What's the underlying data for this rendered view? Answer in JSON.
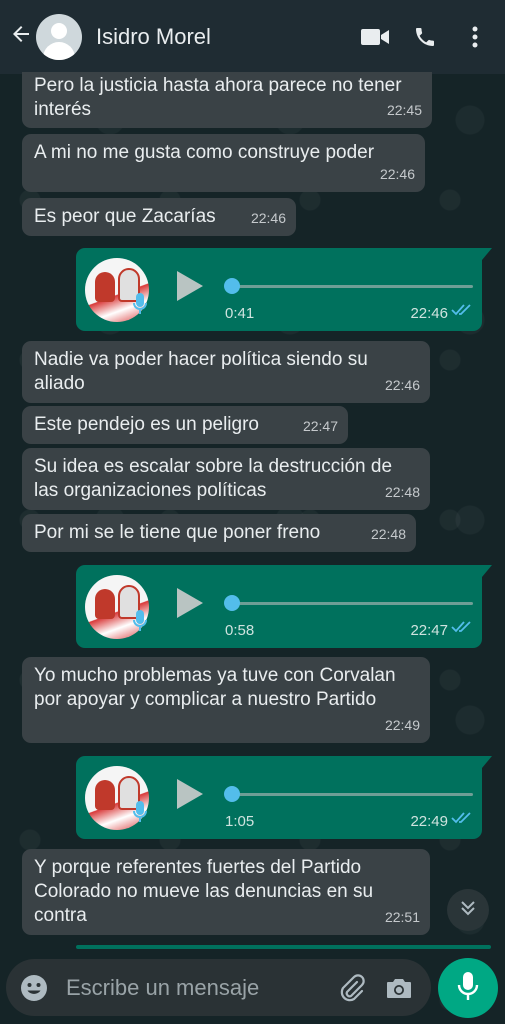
{
  "header": {
    "contact_name": "Isidro Morel"
  },
  "messages": [
    {
      "text": "Pero la justicia hasta ahora parece no tener interés",
      "time": "22:45"
    },
    {
      "text": "A mi no me gusta como construye poder",
      "time": "22:46"
    },
    {
      "text": "Es peor que Zacarías",
      "time": "22:46"
    },
    {
      "text": "Nadie va poder hacer política siendo su aliado",
      "time": "22:46"
    },
    {
      "text": "Este pendejo es un peligro",
      "time": "22:47"
    },
    {
      "text": "Su idea es escalar sobre la destrucción de las organizaciones políticas",
      "time": "22:48"
    },
    {
      "text": "Por mi se le tiene que poner freno",
      "time": "22:48"
    },
    {
      "text": "Yo mucho problemas ya tuve con Corvalan por apoyar y complicar a nuestro Partido",
      "time": "22:49"
    },
    {
      "text": "Y porque referentes fuertes del Partido Colorado no mueve las denuncias en su contra",
      "time": "22:51"
    }
  ],
  "voice_notes": [
    {
      "duration": "0:41",
      "time": "22:46",
      "progress": 0
    },
    {
      "duration": "0:58",
      "time": "22:47",
      "progress": 0
    },
    {
      "duration": "1:05",
      "time": "22:49",
      "progress": 0
    }
  ],
  "input": {
    "placeholder": "Escribe un mensaje"
  },
  "colors": {
    "header_bg": "#1f2c33",
    "incoming_bubble": "#3a4246",
    "outgoing_bubble": "#00715d",
    "accent": "#00a884",
    "read_ticks": "#53bdeb"
  },
  "icons": [
    "back-arrow-icon",
    "video-call-icon",
    "phone-icon",
    "more-vert-icon",
    "play-icon",
    "mic-icon",
    "double-check-icon",
    "chevron-double-down-icon",
    "emoji-icon",
    "attach-icon",
    "camera-icon"
  ]
}
